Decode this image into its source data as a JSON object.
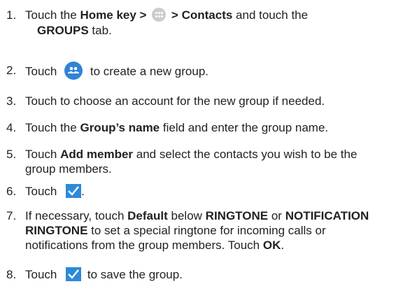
{
  "steps": [
    {
      "num": "1.",
      "parts": [
        "Touch the",
        "Home",
        "key >",
        "> Contacts",
        "and touch the",
        "GROUPS",
        "tab."
      ]
    },
    {
      "num": "2.",
      "parts": [
        "Touch",
        "to create a new group."
      ]
    },
    {
      "num": "3.",
      "parts": [
        "Touch to choose an account for the new group if needed."
      ]
    },
    {
      "num": "4.",
      "parts": [
        "Touch the",
        "Group’s name",
        "field and enter the group name."
      ]
    },
    {
      "num": "5.",
      "parts": [
        "Touch",
        "Add member",
        "and select the contacts you wish to be the group members."
      ]
    },
    {
      "num": "6.",
      "parts": [
        "Touch",
        "."
      ]
    },
    {
      "num": "7.",
      "parts": [
        "If necessary, touch",
        "Default",
        "below",
        "RINGTONE",
        "or",
        "NOTIFICATION RINGTONE",
        "to set a special ringtone for incoming calls or notifications from the group members. Touch",
        "OK",
        "."
      ]
    },
    {
      "num": "8.",
      "parts": [
        "Touch",
        "to save the group."
      ]
    }
  ],
  "icons": {
    "apps_icon": "apps-grid-icon",
    "new_group_icon": "new-group-icon",
    "check_icon": "check-icon",
    "colors": {
      "apps_icon": "#c9cdd2",
      "new_group_fab": "#2f84d6",
      "check": "#2d8ad8"
    }
  }
}
